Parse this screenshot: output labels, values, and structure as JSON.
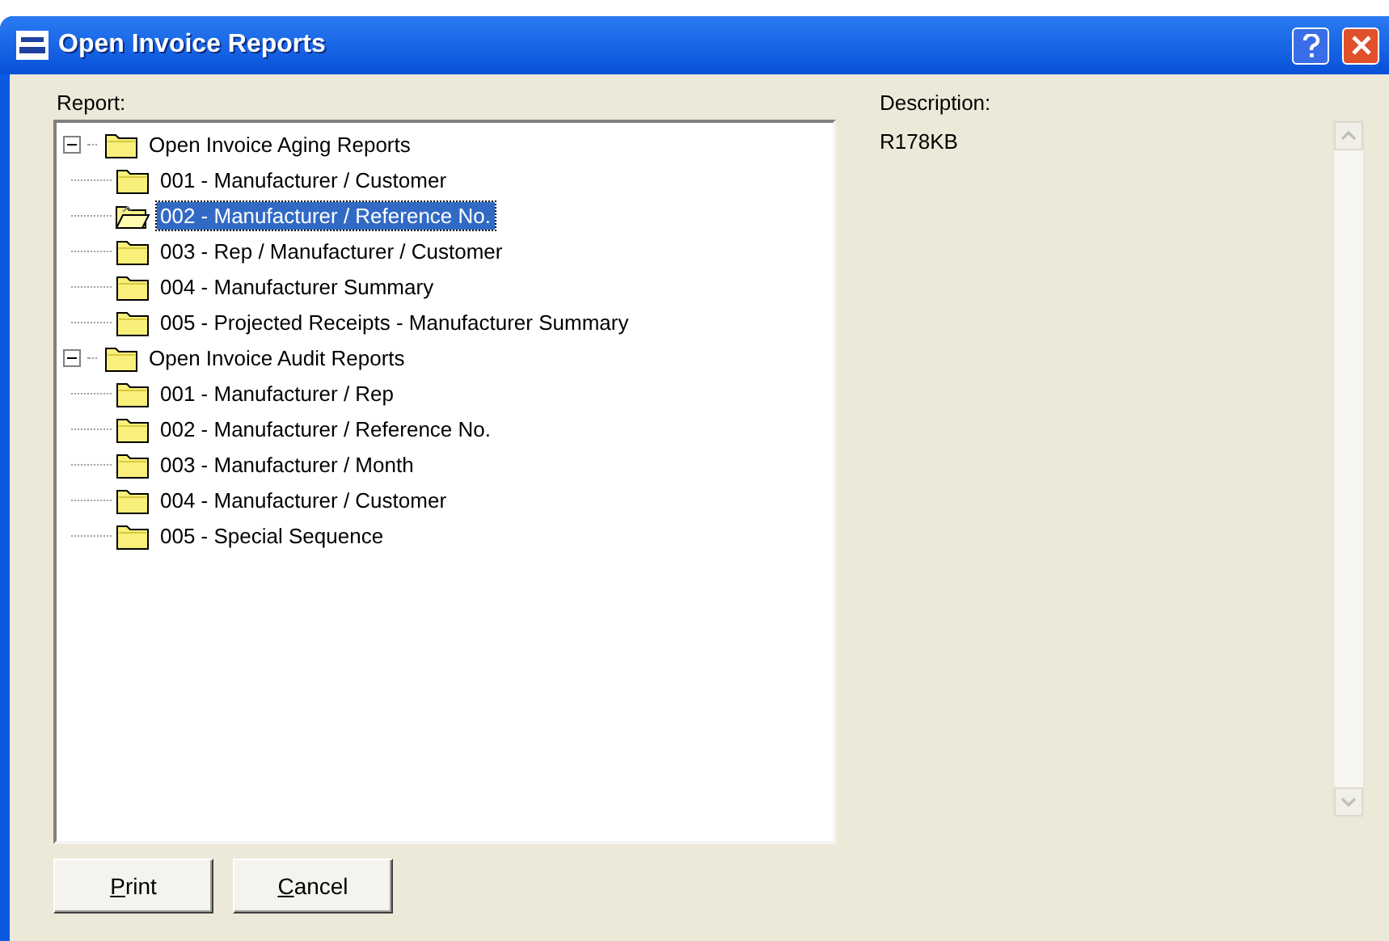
{
  "window": {
    "title": "Open Invoice Reports"
  },
  "report_label": "Report:",
  "description_label": "Description:",
  "description": "R178KB",
  "tree": [
    {
      "label": "Open Invoice Aging Reports",
      "expanded": true,
      "selected": false,
      "children": [
        {
          "label": "001 - Manufacturer / Customer",
          "selected": false
        },
        {
          "label": "002 - Manufacturer / Reference No.",
          "selected": true
        },
        {
          "label": "003 - Rep / Manufacturer / Customer",
          "selected": false
        },
        {
          "label": "004 - Manufacturer Summary",
          "selected": false
        },
        {
          "label": "005 - Projected Receipts - Manufacturer Summary",
          "selected": false
        }
      ]
    },
    {
      "label": "Open Invoice Audit Reports",
      "expanded": true,
      "selected": false,
      "children": [
        {
          "label": "001 - Manufacturer / Rep",
          "selected": false
        },
        {
          "label": "002 - Manufacturer / Reference No.",
          "selected": false
        },
        {
          "label": "003 - Manufacturer / Month",
          "selected": false
        },
        {
          "label": "004 - Manufacturer / Customer",
          "selected": false
        },
        {
          "label": "005 - Special Sequence",
          "selected": false
        }
      ]
    }
  ],
  "buttons": [
    {
      "label": "Print",
      "underlined_access_key": true
    },
    {
      "label": "Cancel",
      "underlined_access_key": true
    }
  ]
}
